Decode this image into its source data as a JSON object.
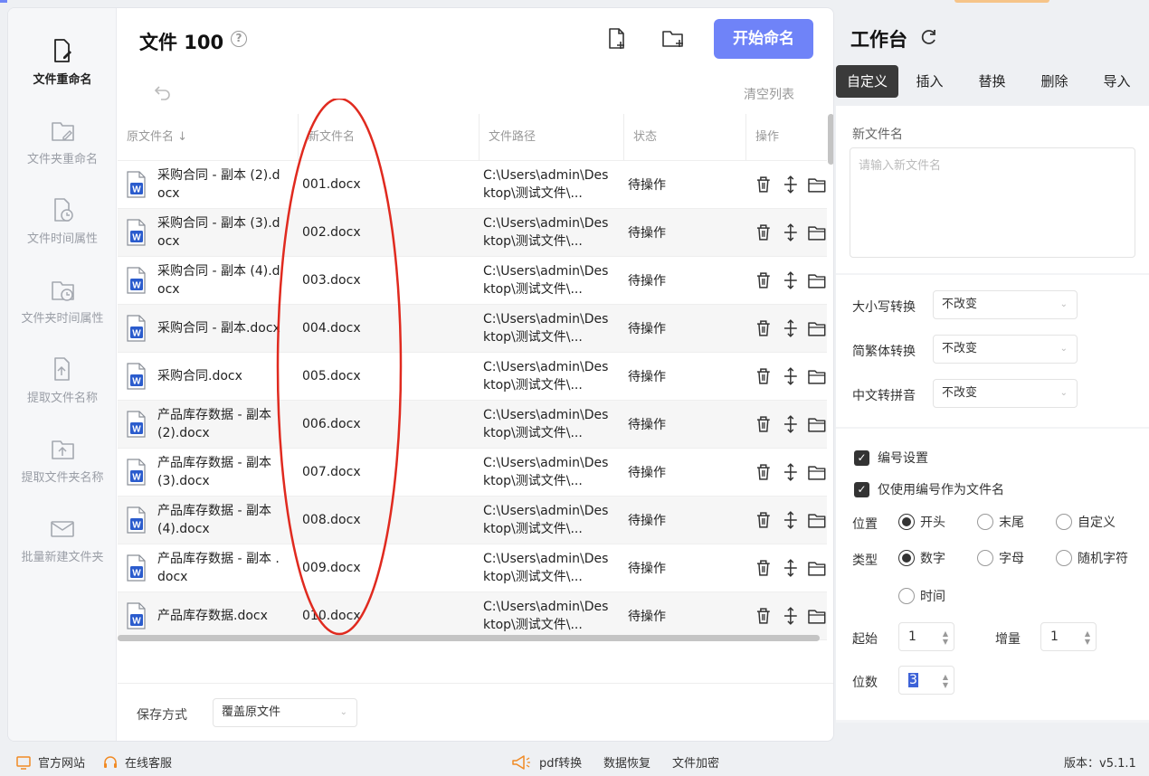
{
  "header": {
    "title": "文件 100",
    "help_icon": "?",
    "start_button": "开始命名",
    "clear_list": "清空列表"
  },
  "nav": {
    "items": [
      {
        "label": "文件重命名",
        "icon": "file-edit-icon",
        "active": true
      },
      {
        "label": "文件夹重命名",
        "icon": "folder-edit-icon",
        "active": false
      },
      {
        "label": "文件时间属性",
        "icon": "file-clock-icon",
        "active": false
      },
      {
        "label": "文件夹时间属性",
        "icon": "folder-clock-icon",
        "active": false
      },
      {
        "label": "提取文件名称",
        "icon": "file-extract-icon",
        "active": false
      },
      {
        "label": "提取文件夹名称",
        "icon": "folder-extract-icon",
        "active": false
      },
      {
        "label": "批量新建文件夹",
        "icon": "batch-folder-icon",
        "active": false
      }
    ]
  },
  "table": {
    "columns": [
      "原文件名 ↓",
      "新文件名",
      "文件路径",
      "状态",
      "操作"
    ],
    "rows": [
      {
        "orig": "采购合同 - 副本 (2).docx",
        "new": "001.docx",
        "path": "C:\\Users\\admin\\Desktop\\测试文件\\...",
        "status": "待操作"
      },
      {
        "orig": "采购合同 - 副本 (3).docx",
        "new": "002.docx",
        "path": "C:\\Users\\admin\\Desktop\\测试文件\\...",
        "status": "待操作"
      },
      {
        "orig": "采购合同 - 副本 (4).docx",
        "new": "003.docx",
        "path": "C:\\Users\\admin\\Desktop\\测试文件\\...",
        "status": "待操作"
      },
      {
        "orig": "采购合同 - 副本.docx",
        "new": "004.docx",
        "path": "C:\\Users\\admin\\Desktop\\测试文件\\...",
        "status": "待操作"
      },
      {
        "orig": "采购合同.docx",
        "new": "005.docx",
        "path": "C:\\Users\\admin\\Desktop\\测试文件\\...",
        "status": "待操作"
      },
      {
        "orig": "产品库存数据 - 副本 (2).docx",
        "new": "006.docx",
        "path": "C:\\Users\\admin\\Desktop\\测试文件\\...",
        "status": "待操作"
      },
      {
        "orig": "产品库存数据 - 副本 (3).docx",
        "new": "007.docx",
        "path": "C:\\Users\\admin\\Desktop\\测试文件\\...",
        "status": "待操作"
      },
      {
        "orig": "产品库存数据 - 副本 (4).docx",
        "new": "008.docx",
        "path": "C:\\Users\\admin\\Desktop\\测试文件\\...",
        "status": "待操作"
      },
      {
        "orig": "产品库存数据 - 副本 .docx",
        "new": "009.docx",
        "path": "C:\\Users\\admin\\Desktop\\测试文件\\...",
        "status": "待操作"
      },
      {
        "orig": "产品库存数据.docx",
        "new": "010.docx",
        "path": "C:\\Users\\admin\\Desktop\\测试文件\\...",
        "status": "待操作"
      }
    ]
  },
  "save": {
    "label": "保存方式",
    "value": "覆盖原文件"
  },
  "workbench": {
    "title": "工作台",
    "tabs": [
      "自定义",
      "插入",
      "替换",
      "删除",
      "导入"
    ],
    "active_tab": "自定义",
    "new_name_label": "新文件名",
    "new_name_placeholder": "请输入新文件名",
    "case_label": "大小写转换",
    "case_value": "不改变",
    "trad_label": "简繁体转换",
    "trad_value": "不改变",
    "pinyin_label": "中文转拼音",
    "pinyin_value": "不改变",
    "numbering_label": "编号设置",
    "numbering_checked": true,
    "only_number_label": "仅使用编号作为文件名",
    "only_number_checked": true,
    "position_label": "位置",
    "position_options": [
      "开头",
      "末尾",
      "自定义"
    ],
    "position_selected": "开头",
    "type_label": "类型",
    "type_options": [
      "数字",
      "字母",
      "随机字符",
      "时间"
    ],
    "type_selected": "数字",
    "start_label": "起始",
    "start_value": "1",
    "step_label": "增量",
    "step_value": "1",
    "digits_label": "位数",
    "digits_value": "3"
  },
  "bottom": {
    "website": "官方网站",
    "service": "在线客服",
    "pdf": "pdf转换",
    "recovery": "数据恢复",
    "encrypt": "文件加密",
    "version": "版本：v5.1.1"
  },
  "colors": {
    "accent": "#6f83f8",
    "tab_active": "#3a3a3a",
    "word_blue": "#2b5ccd",
    "annotation_red": "#e02a1f"
  }
}
